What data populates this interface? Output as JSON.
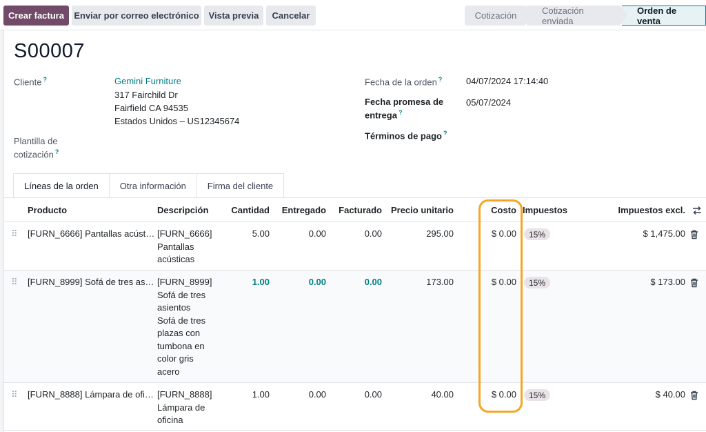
{
  "actions": {
    "create_invoice": "Crear factura",
    "send_email": "Enviar por correo electrónico",
    "preview": "Vista previa",
    "cancel": "Cancelar"
  },
  "status": [
    "Cotización",
    "Cotización enviada",
    "Orden de venta"
  ],
  "record": {
    "name": "S00007",
    "customer_label": "Cliente",
    "customer_name": "Gemini Furniture",
    "address_line1": "317 Fairchild Dr",
    "address_line2": "Fairfield CA 94535",
    "address_line3": "Estados Unidos – US12345674",
    "template_label_1": "Plantilla de",
    "template_label_2": "cotización",
    "order_date_label": "Fecha de la orden",
    "order_date": "04/07/2024 17:14:40",
    "delivery_label_1": "Fecha promesa de",
    "delivery_label_2": "entrega",
    "delivery_date": "05/07/2024",
    "payment_terms_label": "Términos de pago"
  },
  "tip_mark": "?",
  "tabs": [
    "Líneas de la orden",
    "Otra información",
    "Firma del cliente"
  ],
  "columns": {
    "product": "Producto",
    "description": "Descripción",
    "quantity": "Cantidad",
    "delivered": "Entregado",
    "invoiced": "Facturado",
    "unit_price": "Precio unitario",
    "cost": "Costo",
    "taxes": "Impuestos",
    "subtotal": "Impuestos excl."
  },
  "lines": [
    {
      "product": "[FURN_6666] Pantallas acúst…",
      "description": [
        "[FURN_6666]",
        "Pantallas",
        "acústicas"
      ],
      "quantity": "5.00",
      "delivered": "0.00",
      "invoiced": "0.00",
      "unit_price": "295.00",
      "cost": "$ 0.00",
      "tax": "15%",
      "subtotal": "$ 1,475.00"
    },
    {
      "product": "[FURN_8999] Sofá de tres as…",
      "description": [
        "[FURN_8999]",
        "Sofá de tres",
        "asientos",
        "Sofá de tres",
        "plazas con",
        "tumbona en",
        "color gris",
        "acero"
      ],
      "quantity": "1.00",
      "delivered": "0.00",
      "invoiced": "0.00",
      "unit_price": "173.00",
      "cost": "$ 0.00",
      "tax": "15%",
      "subtotal": "$ 173.00"
    },
    {
      "product": "[FURN_8888] Lámpara de ofi…",
      "description": [
        "[FURN_8888]",
        "Lámpara de",
        "oficina"
      ],
      "quantity": "1.00",
      "delivered": "0.00",
      "invoiced": "0.00",
      "unit_price": "40.00",
      "cost": "$ 0.00",
      "tax": "15%",
      "subtotal": "$ 40.00"
    }
  ],
  "colors": {
    "primary": "#714b67",
    "accent": "#017e84",
    "highlight": "#f5a623"
  }
}
